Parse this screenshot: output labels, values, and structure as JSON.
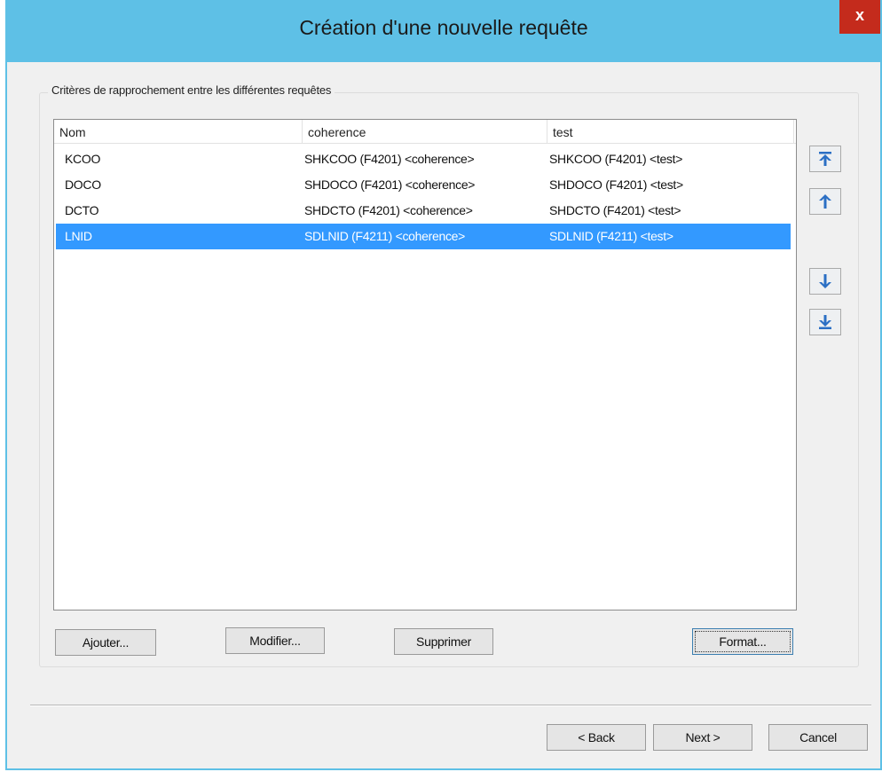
{
  "window": {
    "title": "Création d'une nouvelle requête",
    "close_label": "x"
  },
  "group": {
    "label": "Critères de rapprochement entre les différentes requêtes"
  },
  "list": {
    "columns": [
      "Nom",
      "coherence",
      "test"
    ],
    "rows": [
      [
        "KCOO",
        "SHKCOO (F4201) <coherence>",
        "SHKCOO (F4201) <test>"
      ],
      [
        "DOCO",
        "SHDOCO (F4201) <coherence>",
        "SHDOCO (F4201) <test>"
      ],
      [
        "DCTO",
        "SHDCTO (F4201) <coherence>",
        "SHDCTO (F4201) <test>"
      ],
      [
        "LNID",
        "SDLNID (F4211) <coherence>",
        "SDLNID (F4211) <test>"
      ]
    ],
    "selected_row": 3
  },
  "side_buttons": {
    "move_top_icon": "arrow-top-icon",
    "move_up_icon": "arrow-up-icon",
    "move_down_icon": "arrow-down-icon",
    "move_bottom_icon": "arrow-bottom-icon",
    "icon_color": "#2b6fc4"
  },
  "buttons": {
    "add": "Ajouter...",
    "modify": "Modifier...",
    "delete": "Supprimer",
    "format": "Format..."
  },
  "nav": {
    "back": "< Back",
    "next": "Next >",
    "cancel": "Cancel"
  },
  "colors": {
    "titlebar": "#5ec0e6",
    "selection": "#3399ff",
    "close": "#c42b1c"
  }
}
